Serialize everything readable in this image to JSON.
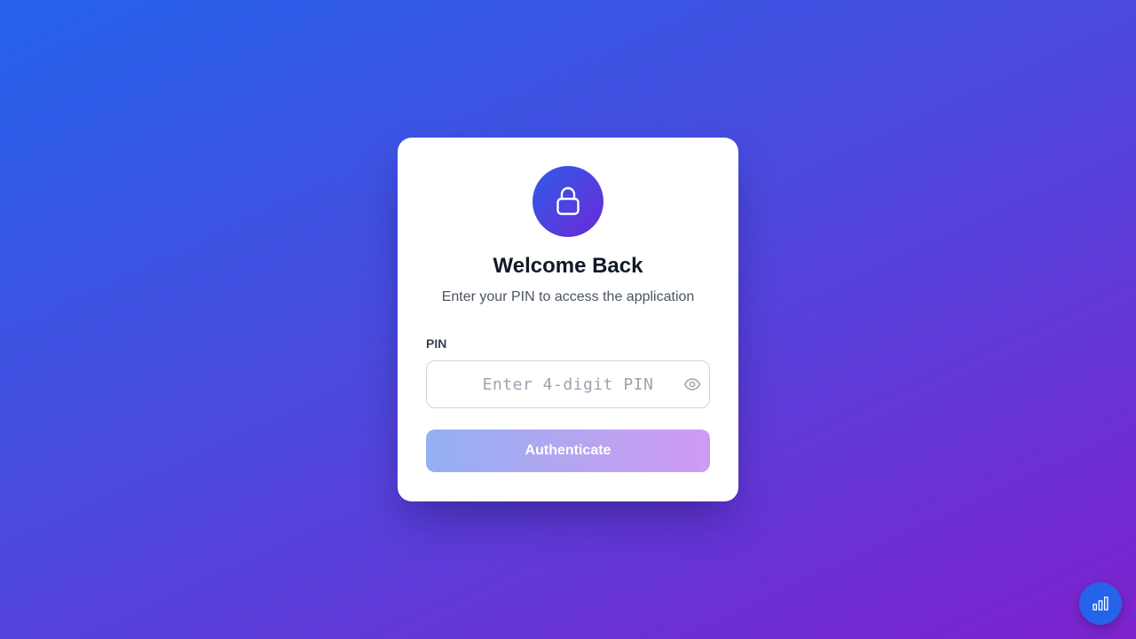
{
  "login": {
    "title": "Welcome Back",
    "subtitle": "Enter your PIN to access the application",
    "pin_label": "PIN",
    "pin_value": "",
    "pin_placeholder": "Enter 4-digit PIN",
    "submit_label": "Authenticate"
  },
  "icons": {
    "lock": "lock-icon",
    "toggle_visibility": "eye-icon",
    "floating_action": "bar-chart-icon"
  },
  "colors": {
    "background_start": "#2563eb",
    "background_end": "#7e22ce",
    "accent_blue": "#2563eb",
    "accent_purple": "#6d28d9",
    "title_text": "#111827",
    "subtitle_text": "#4b5563"
  }
}
